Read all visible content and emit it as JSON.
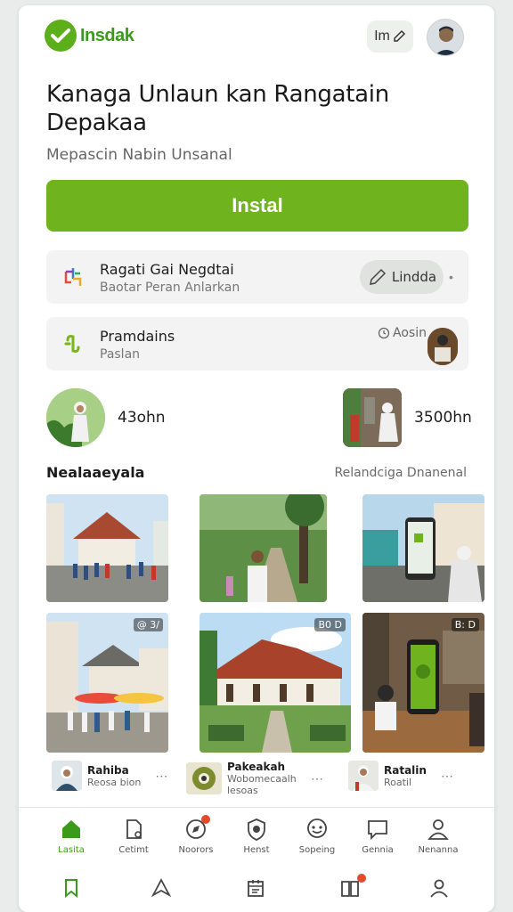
{
  "header": {
    "logo_text": "Insdak",
    "pill_text": "Im"
  },
  "hero": {
    "title": "Kanaga Unlaun kan Rangatain Depakaa",
    "subtitle": "Mepascin Nabin Unsanal",
    "install_label": "Instal"
  },
  "rows": [
    {
      "title": "Ragati Gai Negdtai",
      "subtitle": "Baotar Peran Anlarkan",
      "action_label": "Lindda"
    },
    {
      "title": "Pramdains",
      "subtitle": "Paslan",
      "meta": "Aosin"
    }
  ],
  "stats": [
    {
      "value": "43ohn"
    },
    {
      "value": "3500hn"
    }
  ],
  "section": {
    "left": "Nealaaeyala",
    "right": "Relandciga Dnanenal"
  },
  "gallery_badges": [
    "@ 3/",
    "B0 D",
    "B: D"
  ],
  "mini_cards": [
    {
      "title": "Rahiba",
      "subtitle": "Reosa bion"
    },
    {
      "title": "Pakeakah",
      "subtitle": "Wobomecaalh lesoas"
    },
    {
      "title": "Ratalin",
      "subtitle": "Roatil"
    }
  ],
  "nav": [
    {
      "label": "Lasita",
      "icon": "home-icon"
    },
    {
      "label": "Cetimt",
      "icon": "document-icon"
    },
    {
      "label": "Noorors",
      "icon": "compass-icon"
    },
    {
      "label": "Henst",
      "icon": "shield-icon"
    },
    {
      "label": "Sopeing",
      "icon": "chat-bubble-icon"
    },
    {
      "label": "Gennia",
      "icon": "message-icon"
    },
    {
      "label": "Nenanna",
      "icon": "profile-icon"
    }
  ],
  "colors": {
    "accent": "#6fb41e",
    "brand": "#3b9a1a",
    "notification": "#e24a2c"
  }
}
